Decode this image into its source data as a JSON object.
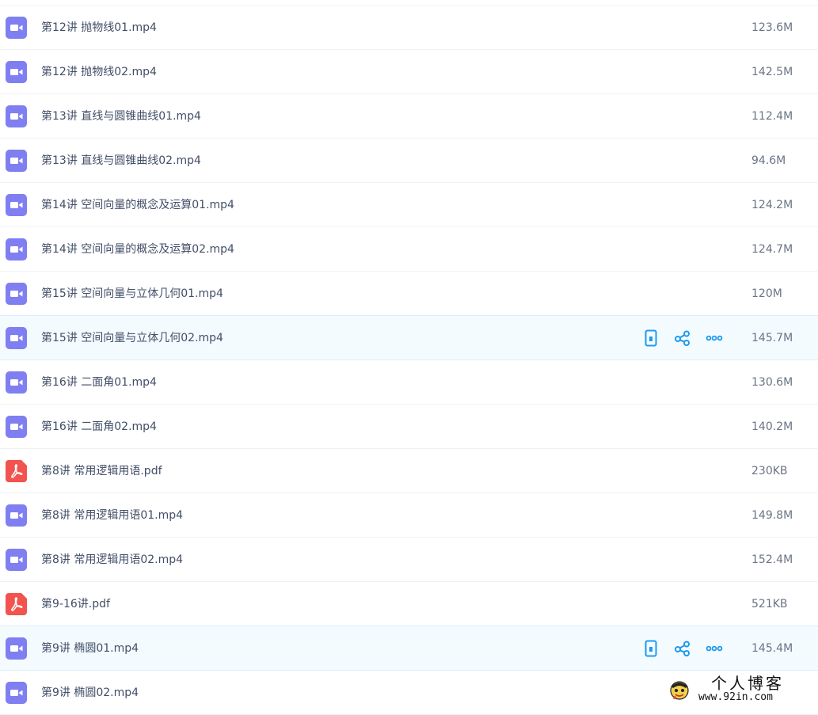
{
  "files": [
    {
      "name": "第12讲 抛物线01.mp4",
      "size": "123.6M",
      "type": "video",
      "hovered": false
    },
    {
      "name": "第12讲 抛物线02.mp4",
      "size": "142.5M",
      "type": "video",
      "hovered": false
    },
    {
      "name": "第13讲 直线与圆锥曲线01.mp4",
      "size": "112.4M",
      "type": "video",
      "hovered": false
    },
    {
      "name": "第13讲 直线与圆锥曲线02.mp4",
      "size": "94.6M",
      "type": "video",
      "hovered": false
    },
    {
      "name": "第14讲 空间向量的概念及运算01.mp4",
      "size": "124.2M",
      "type": "video",
      "hovered": false
    },
    {
      "name": "第14讲 空间向量的概念及运算02.mp4",
      "size": "124.7M",
      "type": "video",
      "hovered": false
    },
    {
      "name": "第15讲 空间向量与立体几何01.mp4",
      "size": "120M",
      "type": "video",
      "hovered": false
    },
    {
      "name": "第15讲 空间向量与立体几何02.mp4",
      "size": "145.7M",
      "type": "video",
      "hovered": true
    },
    {
      "name": "第16讲 二面角01.mp4",
      "size": "130.6M",
      "type": "video",
      "hovered": false
    },
    {
      "name": "第16讲 二面角02.mp4",
      "size": "140.2M",
      "type": "video",
      "hovered": false
    },
    {
      "name": "第8讲 常用逻辑用语.pdf",
      "size": "230KB",
      "type": "pdf",
      "hovered": false
    },
    {
      "name": "第8讲 常用逻辑用语01.mp4",
      "size": "149.8M",
      "type": "video",
      "hovered": false
    },
    {
      "name": "第8讲 常用逻辑用语02.mp4",
      "size": "152.4M",
      "type": "video",
      "hovered": false
    },
    {
      "name": "第9-16讲.pdf",
      "size": "521KB",
      "type": "pdf",
      "hovered": false
    },
    {
      "name": "第9讲 椭圆01.mp4",
      "size": "145.4M",
      "type": "video",
      "hovered": true
    },
    {
      "name": "第9讲 椭圆02.mp4",
      "size": "",
      "type": "video",
      "hovered": false
    }
  ],
  "row_action_icons": [
    "phone-icon",
    "share-icon",
    "more-icon"
  ],
  "colors": {
    "video_icon": "#7f7ff2",
    "pdf_icon": "#f2534f",
    "action_icon": "#1d9bf0",
    "hover_row": "#f4fbff"
  },
  "watermark": {
    "title": "个人博客",
    "url": "www.92in.com"
  }
}
